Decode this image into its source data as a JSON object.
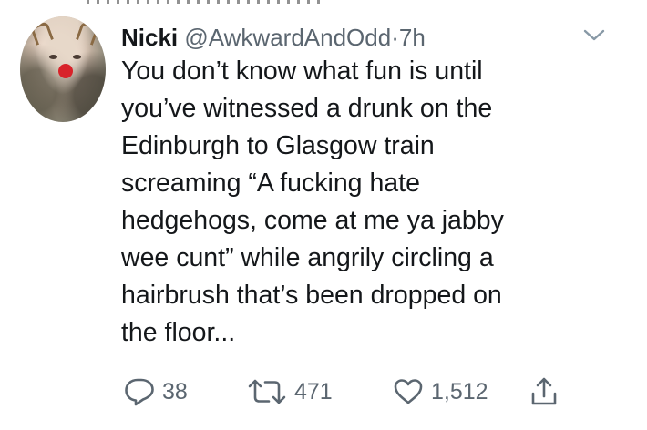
{
  "tweet": {
    "author_name": "Nicki",
    "handle": "@AwkwardAndOdd",
    "separator": "·",
    "time": "7h",
    "text_lines": [
      "You don’t know what fun is until",
      "you’ve witnessed a drunk on the",
      "Edinburgh to Glasgow train",
      "screaming “A fucking hate",
      "hedgehogs, come at me ya jabby",
      "wee cunt” while angrily circling a",
      "hairbrush that’s been dropped on",
      "the floor..."
    ]
  },
  "actions": {
    "reply": {
      "icon": "reply-icon",
      "count": "38"
    },
    "retweet": {
      "icon": "retweet-icon",
      "count": "471"
    },
    "like": {
      "icon": "heart-icon",
      "count": "1,512"
    },
    "share": {
      "icon": "share-icon"
    }
  },
  "colors": {
    "text": "#14171a",
    "muted": "#5b6670",
    "background": "#ffffff"
  }
}
